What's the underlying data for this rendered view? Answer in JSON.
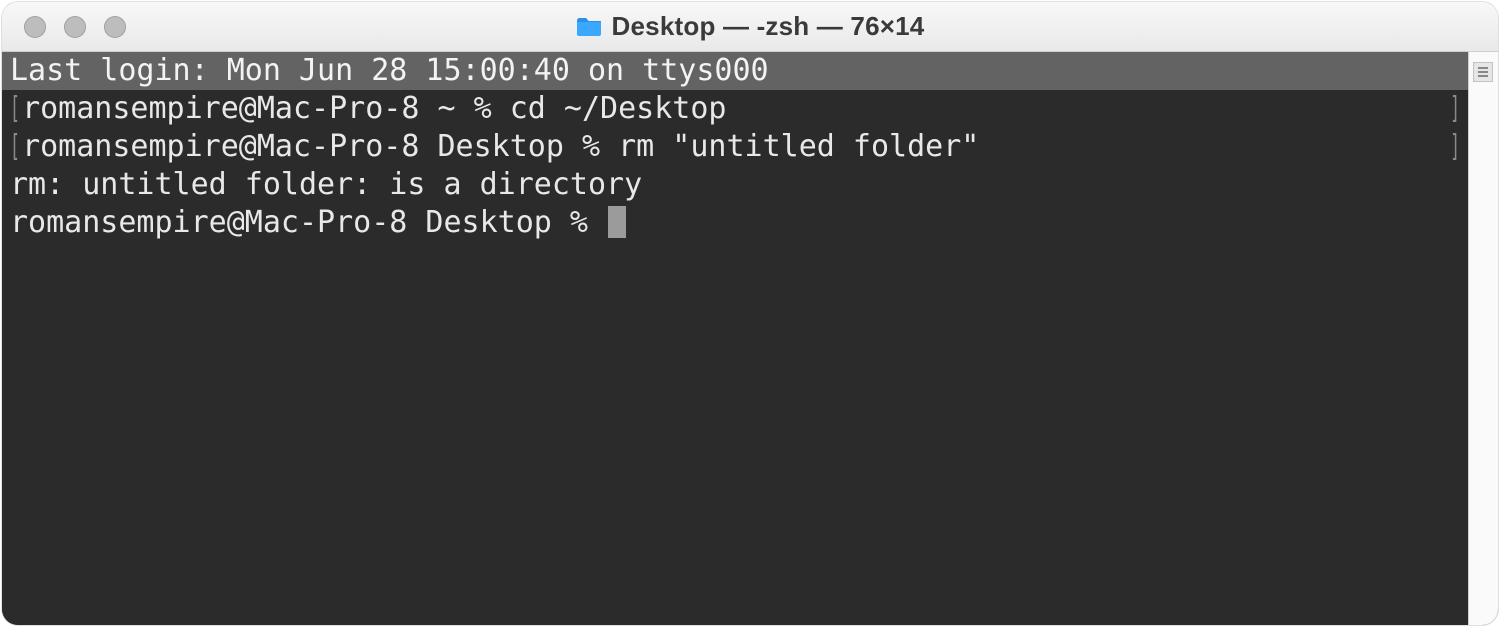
{
  "window": {
    "title": "Desktop — -zsh — 76×14"
  },
  "terminal": {
    "last_login": "Last login: Mon Jun 28 15:00:40 on ttys000",
    "lines": [
      {
        "prompt": "romansempire@Mac-Pro-8 ~ % ",
        "command": "cd ~/Desktop",
        "bracketed": true
      },
      {
        "prompt": "romansempire@Mac-Pro-8 Desktop % ",
        "command": "rm \"untitled folder\"",
        "bracketed": true
      },
      {
        "output": "rm: untitled folder: is a directory"
      }
    ],
    "current_prompt": "romansempire@Mac-Pro-8 Desktop % "
  }
}
